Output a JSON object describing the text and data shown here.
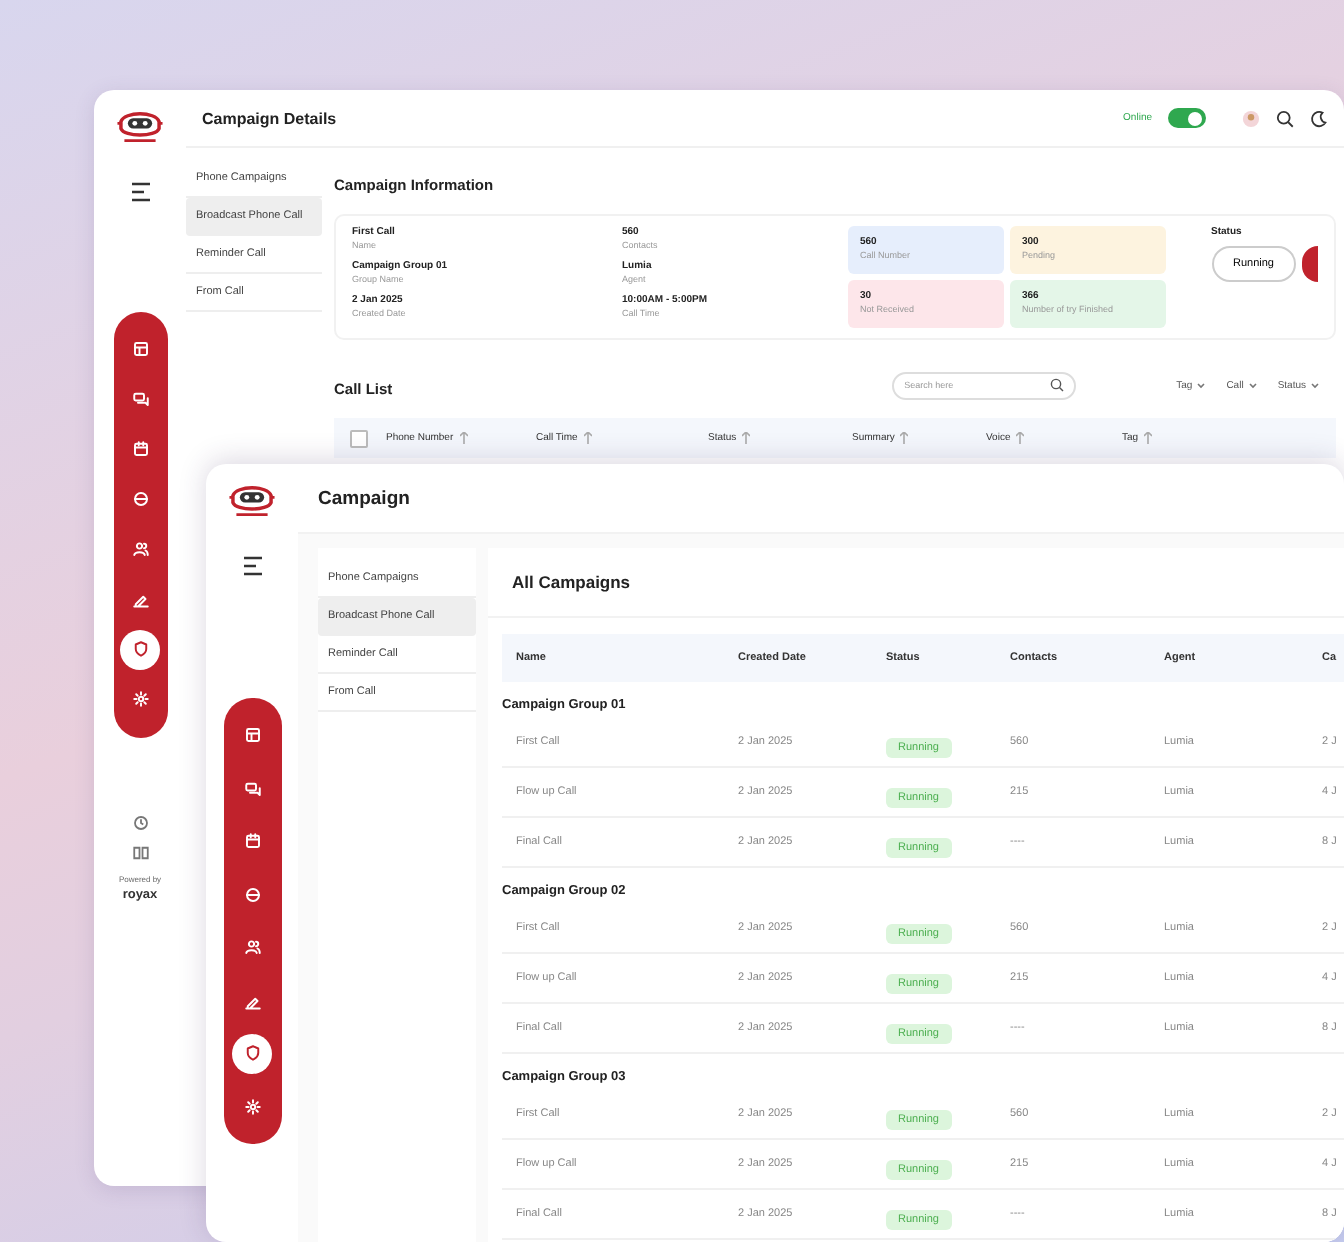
{
  "back_window": {
    "title": "Campaign Details",
    "online": {
      "label": "Online",
      "on": true
    },
    "nav": [
      {
        "kind": "grid",
        "selected": false
      },
      {
        "kind": "chat",
        "selected": false
      },
      {
        "kind": "calendar",
        "selected": false
      },
      {
        "kind": "globe",
        "selected": false
      },
      {
        "kind": "users",
        "selected": false
      },
      {
        "kind": "pen",
        "selected": false
      },
      {
        "kind": "shield",
        "selected": true
      },
      {
        "kind": "gear",
        "selected": false
      }
    ],
    "subnav": [
      {
        "label": "Phone Campaigns",
        "selected": false
      },
      {
        "label": "Broadcast Phone Call",
        "selected": true
      },
      {
        "label": "Reminder Call",
        "selected": false
      },
      {
        "label": "From Call",
        "selected": false
      }
    ],
    "info_title": "Campaign Information",
    "info_fields": [
      {
        "value": "First Call",
        "label": "Name"
      },
      {
        "value": "560",
        "label": "Contacts"
      },
      {
        "value": "Campaign Group 01",
        "label": "Group Name"
      },
      {
        "value": "Lumia",
        "label": "Agent"
      },
      {
        "value": "2 Jan 2025",
        "label": "Created Date"
      },
      {
        "value": "10:00AM - 5:00PM",
        "label": "Call Time"
      }
    ],
    "stats": [
      {
        "value": "560",
        "label": "Call Number",
        "color": "#e6eefc"
      },
      {
        "value": "300",
        "label": "Pending",
        "color": "#fdf3df"
      },
      {
        "value": "30",
        "label": "Not Received",
        "color": "#fde6ea"
      },
      {
        "value": "366",
        "label": "Number of try Finished",
        "color": "#e4f6e8"
      }
    ],
    "status": {
      "label": "Status",
      "value": "Running"
    },
    "call_list": {
      "title": "Call List",
      "search_placeholder": "Search here",
      "filters": [
        "Tag",
        "Call",
        "Status"
      ],
      "select_all": {
        "checked": false
      },
      "columns": [
        "Phone Number",
        "Call Time",
        "Status",
        "Summary",
        "Voice",
        "Tag"
      ]
    },
    "footer": {
      "powered_by": "Powered by",
      "brand": "royax"
    }
  },
  "front_window": {
    "title": "Campaign",
    "nav": [
      {
        "kind": "grid",
        "selected": false
      },
      {
        "kind": "chat",
        "selected": false
      },
      {
        "kind": "calendar",
        "selected": false
      },
      {
        "kind": "globe",
        "selected": false
      },
      {
        "kind": "users",
        "selected": false
      },
      {
        "kind": "pen",
        "selected": false
      },
      {
        "kind": "shield",
        "selected": true
      },
      {
        "kind": "gear",
        "selected": false
      }
    ],
    "subnav": [
      {
        "label": "Phone Campaigns",
        "selected": false
      },
      {
        "label": "Broadcast Phone Call",
        "selected": true
      },
      {
        "label": "Reminder Call",
        "selected": false
      },
      {
        "label": "From Call",
        "selected": false
      }
    ],
    "card_title": "All Campaigns",
    "columns": [
      "Name",
      "Created Date",
      "Status",
      "Contacts",
      "Agent",
      "Ca"
    ],
    "groups": [
      {
        "title": "Campaign Group 01",
        "rows": [
          {
            "name": "First Call",
            "created": "2 Jan 2025",
            "status": "Running",
            "contacts": "560",
            "agent": "Lumia",
            "column_6": "2 J"
          },
          {
            "name": "Flow up Call",
            "created": "2 Jan 2025",
            "status": "Running",
            "contacts": "215",
            "agent": "Lumia",
            "column_6": "4 J"
          },
          {
            "name": "Final Call",
            "created": "2 Jan 2025",
            "status": "Running",
            "contacts": "----",
            "agent": "Lumia",
            "column_6": "8 J"
          }
        ]
      },
      {
        "title": "Campaign Group 02",
        "rows": [
          {
            "name": "First Call",
            "created": "2 Jan 2025",
            "status": "Running",
            "contacts": "560",
            "agent": "Lumia",
            "column_6": "2 J"
          },
          {
            "name": "Flow up Call",
            "created": "2 Jan 2025",
            "status": "Running",
            "contacts": "215",
            "agent": "Lumia",
            "column_6": "4 J"
          },
          {
            "name": "Final Call",
            "created": "2 Jan 2025",
            "status": "Running",
            "contacts": "----",
            "agent": "Lumia",
            "column_6": "8 J"
          }
        ]
      },
      {
        "title": "Campaign Group 03",
        "rows": [
          {
            "name": "First Call",
            "created": "2 Jan 2025",
            "status": "Running",
            "contacts": "560",
            "agent": "Lumia",
            "column_6": "2 J"
          },
          {
            "name": "Flow up Call",
            "created": "2 Jan 2025",
            "status": "Running",
            "contacts": "215",
            "agent": "Lumia",
            "column_6": "4 J"
          },
          {
            "name": "Final Call",
            "created": "2 Jan 2025",
            "status": "Running",
            "contacts": "----",
            "agent": "Lumia",
            "column_6": "8 J"
          }
        ]
      }
    ]
  }
}
